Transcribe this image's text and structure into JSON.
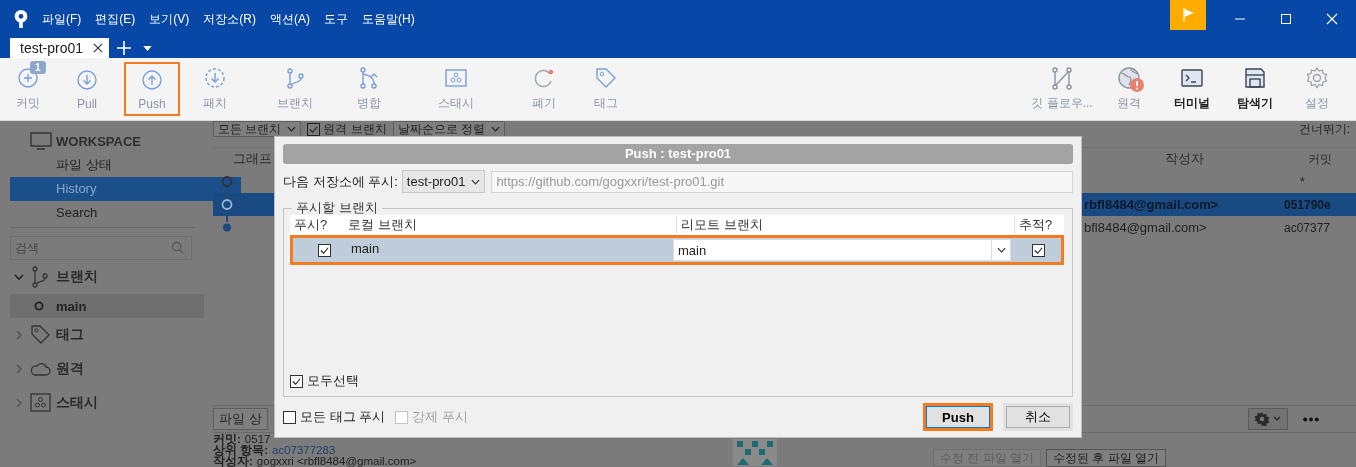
{
  "menu": [
    "파일(F)",
    "편집(E)",
    "보기(V)",
    "저장소(R)",
    "액션(A)",
    "도구",
    "도움말(H)"
  ],
  "tabs": [
    {
      "label": "test-pro01",
      "selected": true
    }
  ],
  "toolbar": {
    "left": [
      {
        "label": "커밋",
        "badge": "1",
        "highlighted": false
      },
      {
        "label": "Pull",
        "highlighted": false
      },
      {
        "label": "Push",
        "highlighted": true
      },
      {
        "label": "패치",
        "highlighted": false
      },
      {
        "label": "브랜치",
        "highlighted": false
      },
      {
        "label": "병합",
        "highlighted": false
      },
      {
        "label": "스태시",
        "highlighted": false
      },
      {
        "label": "폐기",
        "highlighted": false
      },
      {
        "label": "태그",
        "highlighted": false
      }
    ],
    "right": [
      {
        "label": "깃 플로우...",
        "emphasized": false,
        "alert": false
      },
      {
        "label": "원격",
        "emphasized": false,
        "alert": true
      },
      {
        "label": "터미널",
        "emphasized": true,
        "alert": false
      },
      {
        "label": "탐색기",
        "emphasized": true,
        "alert": false
      },
      {
        "label": "설정",
        "emphasized": false,
        "alert": false
      }
    ]
  },
  "sidebar": {
    "workspace": "WORKSPACE",
    "items": [
      {
        "label": "파일 상태",
        "selected": false
      },
      {
        "label": "History",
        "selected": true
      },
      {
        "label": "Search",
        "selected": false
      }
    ],
    "search": {
      "placeholder": "검색"
    },
    "tree": [
      {
        "kind": "branches",
        "label": "브랜치",
        "expanded": true,
        "children": [
          {
            "label": "main",
            "selected": true
          }
        ]
      },
      {
        "kind": "tags",
        "label": "태그",
        "expanded": false
      },
      {
        "kind": "remotes",
        "label": "원격",
        "expanded": false
      },
      {
        "kind": "stashes",
        "label": "스태시",
        "expanded": false
      }
    ]
  },
  "history": {
    "filters": [
      {
        "kind": "dropdown",
        "label": "모든 브랜치"
      },
      {
        "kind": "checkbox",
        "label": "원격 브랜치",
        "checked": true
      },
      {
        "kind": "dropdown",
        "label": "날짜순으로 정렬"
      }
    ],
    "skip_label": "건너뛰기:",
    "columns": [
      "그래프",
      "작성자",
      "커밋"
    ],
    "rows": [
      {
        "kind": "uncommitted",
        "commit": "*",
        "selected": false
      },
      {
        "kind": "head",
        "author": "rbfl8484@gmail.com>",
        "commit": "051790e",
        "selected": true
      },
      {
        "kind": "commit",
        "author": "bfl8484@gmail.com>",
        "commit": "ac07377",
        "selected": false
      }
    ]
  },
  "details": {
    "tab": "파일 상",
    "lines": [
      {
        "label": "커밋:",
        "value": "0517",
        "link": false
      },
      {
        "label": "상위 항목:",
        "value": "ac07377283",
        "link": true
      },
      {
        "label": "작성자:",
        "value": "gogxxri <rbfl8484@gmail.com>",
        "link": false
      }
    ],
    "buttons": [
      {
        "label": "수정 전 파일 열기",
        "disabled": true
      },
      {
        "label": "수정된 후 파일 열기",
        "disabled": false
      }
    ]
  },
  "dialog": {
    "title": "Push :  test-pro01",
    "remote_label": "다음 저장소에 푸시:",
    "remote": "test-pro01",
    "url": "https://github.com/gogxxri/test-pro01.git",
    "group_title": "푸시할 브랜치",
    "columns": [
      "푸시?",
      "로컬 브랜치",
      "리모트 브랜치",
      "추적?"
    ],
    "branches": [
      {
        "push": true,
        "local": "main",
        "remote": "main",
        "track": true,
        "highlighted": true
      }
    ],
    "select_all": {
      "label": "모두선택",
      "checked": true
    },
    "options": [
      {
        "label": "모든 태그 푸시",
        "checked": false,
        "disabled": false
      },
      {
        "label": "강제 푸시",
        "checked": false,
        "disabled": true
      }
    ],
    "buttons": [
      {
        "label": "Push",
        "default": true,
        "highlighted": true
      },
      {
        "label": "취소",
        "default": false,
        "highlighted": false
      }
    ]
  }
}
